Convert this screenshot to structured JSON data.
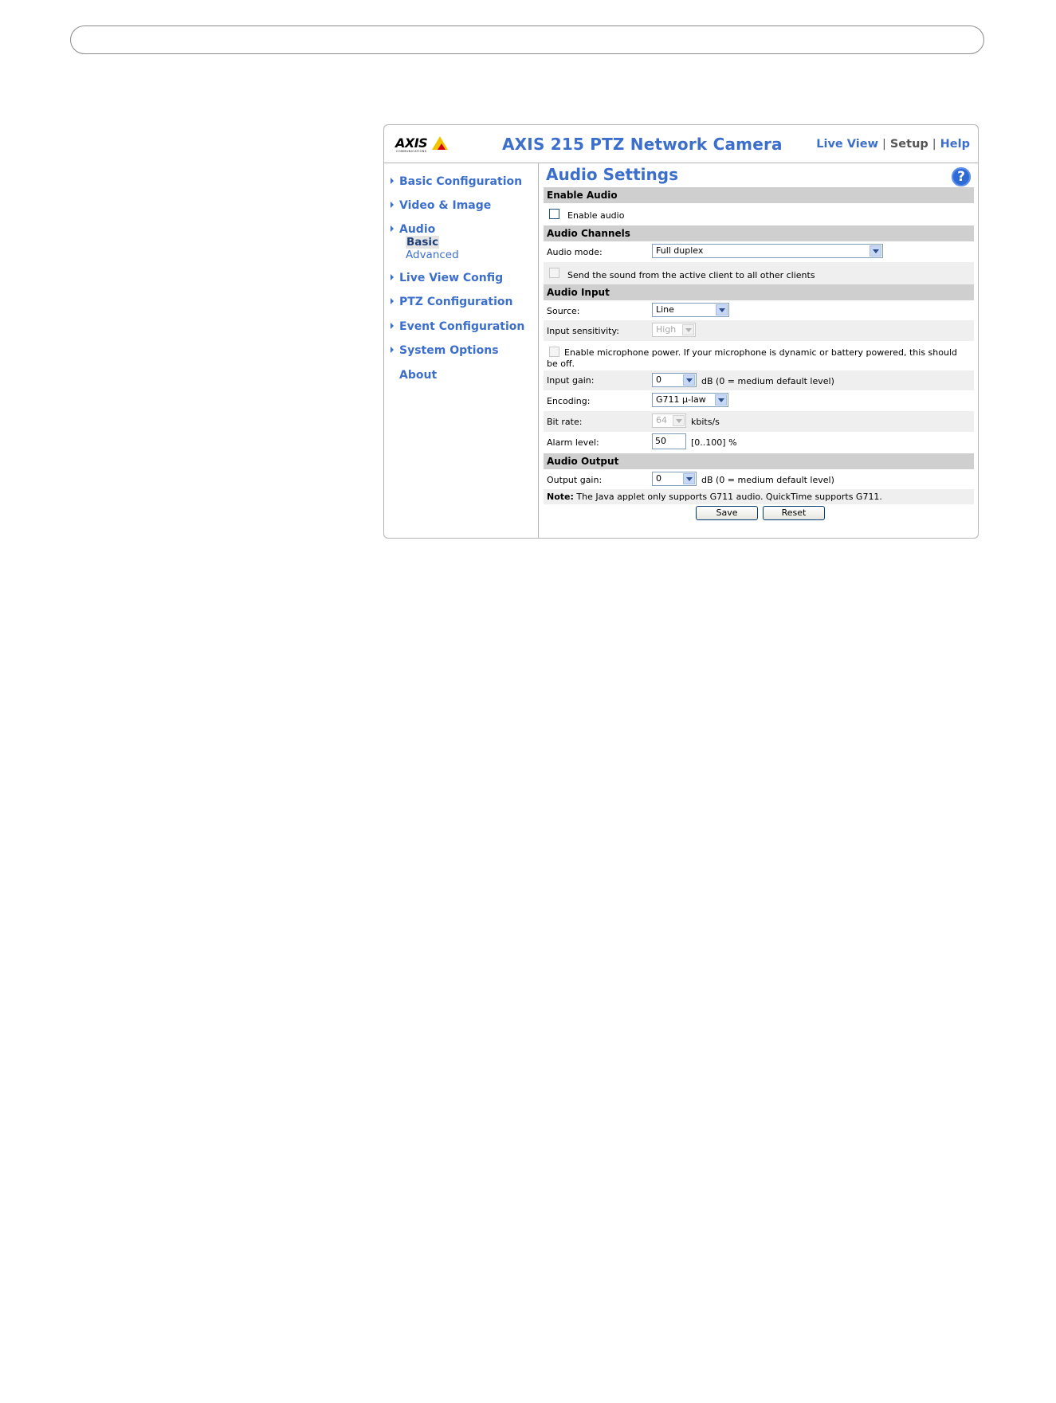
{
  "header": {
    "logo_text": "AXIS",
    "logo_sub": "COMMUNICATIONS",
    "title": "AXIS 215 PTZ Network Camera",
    "links": {
      "live_view": "Live View",
      "setup": "Setup",
      "help": "Help",
      "separator": "|"
    }
  },
  "sidebar": {
    "items": [
      {
        "label": "Basic Configuration"
      },
      {
        "label": "Video & Image"
      },
      {
        "label": "Audio"
      },
      {
        "label": "Live View Config"
      },
      {
        "label": "PTZ Configuration"
      },
      {
        "label": "Event Configuration"
      },
      {
        "label": "System Options"
      },
      {
        "label": "About"
      }
    ],
    "audio_sub": {
      "basic": "Basic",
      "advanced": "Advanced"
    }
  },
  "main": {
    "title": "Audio Settings",
    "help_icon": "?",
    "sections": {
      "enable_audio": "Enable Audio",
      "audio_channels": "Audio Channels",
      "audio_input": "Audio Input",
      "audio_output": "Audio Output"
    },
    "enable_audio_label": "Enable audio",
    "audio_mode": {
      "label": "Audio mode:",
      "value": "Full duplex"
    },
    "send_sound_label": "Send the sound from the active client to all other clients",
    "source": {
      "label": "Source:",
      "value": "Line"
    },
    "input_sensitivity": {
      "label": "Input sensitivity:",
      "value": "High"
    },
    "mic_power_label": "Enable microphone power. If your microphone is dynamic or battery powered, this should be off.",
    "input_gain": {
      "label": "Input gain:",
      "value": "0",
      "suffix": "dB (0 = medium default level)"
    },
    "encoding": {
      "label": "Encoding:",
      "value": "G711 µ-law"
    },
    "bit_rate": {
      "label": "Bit rate:",
      "value": "64",
      "suffix": "kbits/s"
    },
    "alarm_level": {
      "label": "Alarm level:",
      "value": "50",
      "suffix": "[0..100] %"
    },
    "output_gain": {
      "label": "Output gain:",
      "value": "0",
      "suffix": "dB (0 = medium default level)"
    },
    "note": {
      "prefix": "Note:",
      "text": " The Java applet only supports G711 audio. QuickTime supports G711."
    },
    "buttons": {
      "save": "Save",
      "reset": "Reset"
    }
  }
}
